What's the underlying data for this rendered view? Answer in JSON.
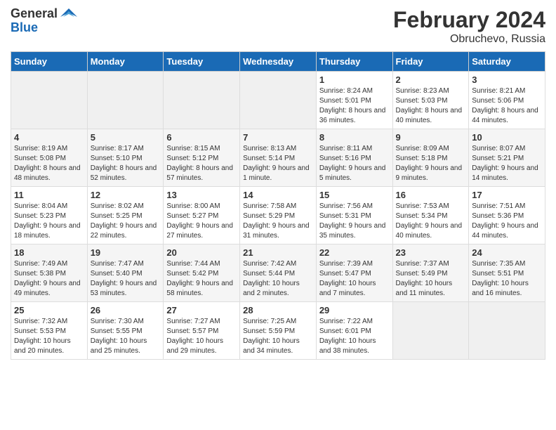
{
  "logo": {
    "general": "General",
    "blue": "Blue"
  },
  "title": "February 2024",
  "subtitle": "Obruchevo, Russia",
  "headers": [
    "Sunday",
    "Monday",
    "Tuesday",
    "Wednesday",
    "Thursday",
    "Friday",
    "Saturday"
  ],
  "weeks": [
    [
      {
        "day": "",
        "sunrise": "",
        "sunset": "",
        "daylight": ""
      },
      {
        "day": "",
        "sunrise": "",
        "sunset": "",
        "daylight": ""
      },
      {
        "day": "",
        "sunrise": "",
        "sunset": "",
        "daylight": ""
      },
      {
        "day": "",
        "sunrise": "",
        "sunset": "",
        "daylight": ""
      },
      {
        "day": "1",
        "sunrise": "Sunrise: 8:24 AM",
        "sunset": "Sunset: 5:01 PM",
        "daylight": "Daylight: 8 hours and 36 minutes."
      },
      {
        "day": "2",
        "sunrise": "Sunrise: 8:23 AM",
        "sunset": "Sunset: 5:03 PM",
        "daylight": "Daylight: 8 hours and 40 minutes."
      },
      {
        "day": "3",
        "sunrise": "Sunrise: 8:21 AM",
        "sunset": "Sunset: 5:06 PM",
        "daylight": "Daylight: 8 hours and 44 minutes."
      }
    ],
    [
      {
        "day": "4",
        "sunrise": "Sunrise: 8:19 AM",
        "sunset": "Sunset: 5:08 PM",
        "daylight": "Daylight: 8 hours and 48 minutes."
      },
      {
        "day": "5",
        "sunrise": "Sunrise: 8:17 AM",
        "sunset": "Sunset: 5:10 PM",
        "daylight": "Daylight: 8 hours and 52 minutes."
      },
      {
        "day": "6",
        "sunrise": "Sunrise: 8:15 AM",
        "sunset": "Sunset: 5:12 PM",
        "daylight": "Daylight: 8 hours and 57 minutes."
      },
      {
        "day": "7",
        "sunrise": "Sunrise: 8:13 AM",
        "sunset": "Sunset: 5:14 PM",
        "daylight": "Daylight: 9 hours and 1 minute."
      },
      {
        "day": "8",
        "sunrise": "Sunrise: 8:11 AM",
        "sunset": "Sunset: 5:16 PM",
        "daylight": "Daylight: 9 hours and 5 minutes."
      },
      {
        "day": "9",
        "sunrise": "Sunrise: 8:09 AM",
        "sunset": "Sunset: 5:18 PM",
        "daylight": "Daylight: 9 hours and 9 minutes."
      },
      {
        "day": "10",
        "sunrise": "Sunrise: 8:07 AM",
        "sunset": "Sunset: 5:21 PM",
        "daylight": "Daylight: 9 hours and 14 minutes."
      }
    ],
    [
      {
        "day": "11",
        "sunrise": "Sunrise: 8:04 AM",
        "sunset": "Sunset: 5:23 PM",
        "daylight": "Daylight: 9 hours and 18 minutes."
      },
      {
        "day": "12",
        "sunrise": "Sunrise: 8:02 AM",
        "sunset": "Sunset: 5:25 PM",
        "daylight": "Daylight: 9 hours and 22 minutes."
      },
      {
        "day": "13",
        "sunrise": "Sunrise: 8:00 AM",
        "sunset": "Sunset: 5:27 PM",
        "daylight": "Daylight: 9 hours and 27 minutes."
      },
      {
        "day": "14",
        "sunrise": "Sunrise: 7:58 AM",
        "sunset": "Sunset: 5:29 PM",
        "daylight": "Daylight: 9 hours and 31 minutes."
      },
      {
        "day": "15",
        "sunrise": "Sunrise: 7:56 AM",
        "sunset": "Sunset: 5:31 PM",
        "daylight": "Daylight: 9 hours and 35 minutes."
      },
      {
        "day": "16",
        "sunrise": "Sunrise: 7:53 AM",
        "sunset": "Sunset: 5:34 PM",
        "daylight": "Daylight: 9 hours and 40 minutes."
      },
      {
        "day": "17",
        "sunrise": "Sunrise: 7:51 AM",
        "sunset": "Sunset: 5:36 PM",
        "daylight": "Daylight: 9 hours and 44 minutes."
      }
    ],
    [
      {
        "day": "18",
        "sunrise": "Sunrise: 7:49 AM",
        "sunset": "Sunset: 5:38 PM",
        "daylight": "Daylight: 9 hours and 49 minutes."
      },
      {
        "day": "19",
        "sunrise": "Sunrise: 7:47 AM",
        "sunset": "Sunset: 5:40 PM",
        "daylight": "Daylight: 9 hours and 53 minutes."
      },
      {
        "day": "20",
        "sunrise": "Sunrise: 7:44 AM",
        "sunset": "Sunset: 5:42 PM",
        "daylight": "Daylight: 9 hours and 58 minutes."
      },
      {
        "day": "21",
        "sunrise": "Sunrise: 7:42 AM",
        "sunset": "Sunset: 5:44 PM",
        "daylight": "Daylight: 10 hours and 2 minutes."
      },
      {
        "day": "22",
        "sunrise": "Sunrise: 7:39 AM",
        "sunset": "Sunset: 5:47 PM",
        "daylight": "Daylight: 10 hours and 7 minutes."
      },
      {
        "day": "23",
        "sunrise": "Sunrise: 7:37 AM",
        "sunset": "Sunset: 5:49 PM",
        "daylight": "Daylight: 10 hours and 11 minutes."
      },
      {
        "day": "24",
        "sunrise": "Sunrise: 7:35 AM",
        "sunset": "Sunset: 5:51 PM",
        "daylight": "Daylight: 10 hours and 16 minutes."
      }
    ],
    [
      {
        "day": "25",
        "sunrise": "Sunrise: 7:32 AM",
        "sunset": "Sunset: 5:53 PM",
        "daylight": "Daylight: 10 hours and 20 minutes."
      },
      {
        "day": "26",
        "sunrise": "Sunrise: 7:30 AM",
        "sunset": "Sunset: 5:55 PM",
        "daylight": "Daylight: 10 hours and 25 minutes."
      },
      {
        "day": "27",
        "sunrise": "Sunrise: 7:27 AM",
        "sunset": "Sunset: 5:57 PM",
        "daylight": "Daylight: 10 hours and 29 minutes."
      },
      {
        "day": "28",
        "sunrise": "Sunrise: 7:25 AM",
        "sunset": "Sunset: 5:59 PM",
        "daylight": "Daylight: 10 hours and 34 minutes."
      },
      {
        "day": "29",
        "sunrise": "Sunrise: 7:22 AM",
        "sunset": "Sunset: 6:01 PM",
        "daylight": "Daylight: 10 hours and 38 minutes."
      },
      {
        "day": "",
        "sunrise": "",
        "sunset": "",
        "daylight": ""
      },
      {
        "day": "",
        "sunrise": "",
        "sunset": "",
        "daylight": ""
      }
    ]
  ]
}
